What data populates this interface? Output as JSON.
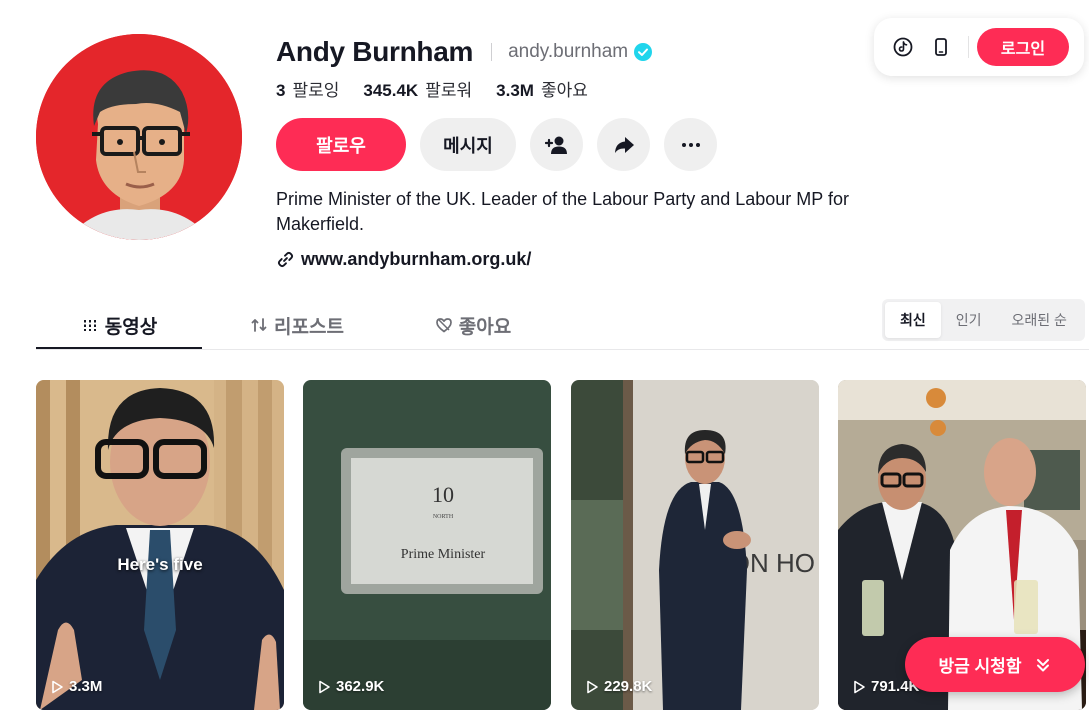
{
  "profile": {
    "display_name": "Andy Burnham",
    "username": "andy.burnham",
    "verified": true,
    "stats": [
      {
        "value": "3",
        "label": "팔로잉"
      },
      {
        "value": "345.4K",
        "label": "팔로워"
      },
      {
        "value": "3.3M",
        "label": "좋아요"
      }
    ],
    "bio": "Prime Minister of the UK. Leader of the Labour Party and Labour MP for Makerfield.",
    "link": "www.andyburnham.org.uk/"
  },
  "actions": {
    "follow_label": "팔로우",
    "message_label": "메시지"
  },
  "topbar": {
    "login_label": "로그인"
  },
  "tabs": [
    {
      "label": "동영상",
      "icon": "grid-icon",
      "active": true
    },
    {
      "label": "리포스트",
      "icon": "repost-icon",
      "active": false
    },
    {
      "label": "좋아요",
      "icon": "heart-icon",
      "active": false
    }
  ],
  "sort": [
    {
      "label": "최신",
      "active": true
    },
    {
      "label": "인기",
      "active": false
    },
    {
      "label": "오래된 순",
      "active": false
    }
  ],
  "videos": [
    {
      "views": "3.3M",
      "caption": "Here's five"
    },
    {
      "views": "362.9K",
      "caption": "",
      "sign_lines": [
        "10",
        "NORTH",
        "Prime Minister"
      ]
    },
    {
      "views": "229.8K",
      "caption": "",
      "wall_text": "RON HO"
    },
    {
      "views": "791.4K",
      "caption": ""
    }
  ],
  "watching_now_label": "방금 시청함",
  "colors": {
    "accent": "#fe2c55",
    "verified": "#20d5ec",
    "text": "#161823",
    "muted": "#6d6e75"
  }
}
